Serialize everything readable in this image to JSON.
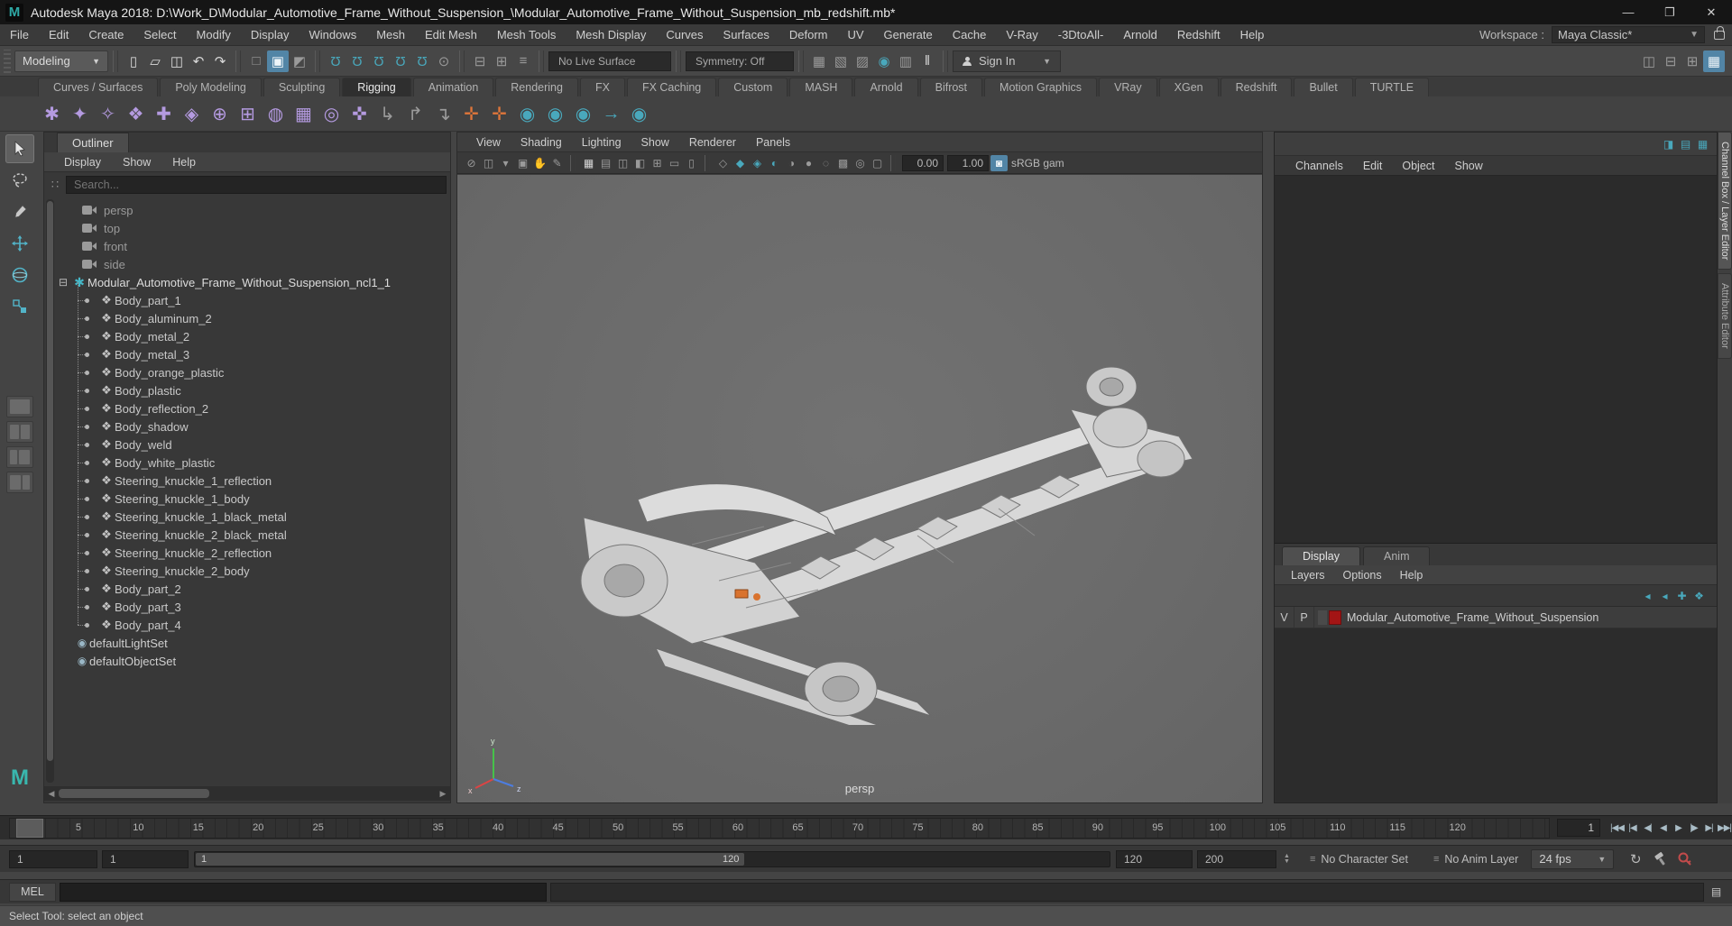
{
  "window": {
    "logo": "M",
    "title": "Autodesk Maya 2018: D:\\Work_D\\Modular_Automotive_Frame_Without_Suspension_\\Modular_Automotive_Frame_Without_Suspension_mb_redshift.mb*",
    "minimize": "—",
    "maximize": "❐",
    "close": "✕"
  },
  "menubar": {
    "items": [
      {
        "label": "File"
      },
      {
        "label": "Edit"
      },
      {
        "label": "Create"
      },
      {
        "label": "Select"
      },
      {
        "label": "Modify"
      },
      {
        "label": "Display"
      },
      {
        "label": "Windows"
      },
      {
        "label": "Mesh"
      },
      {
        "label": "Edit Mesh"
      },
      {
        "label": "Mesh Tools"
      },
      {
        "label": "Mesh Display"
      },
      {
        "label": "Curves"
      },
      {
        "label": "Surfaces"
      },
      {
        "label": "Deform"
      },
      {
        "label": "UV"
      },
      {
        "label": "Generate"
      },
      {
        "label": "Cache"
      },
      {
        "label": "V-Ray"
      },
      {
        "label": "-3DtoAll-"
      },
      {
        "label": "Arnold"
      },
      {
        "label": "Redshift"
      },
      {
        "label": "Help"
      }
    ],
    "workspace_label": "Workspace :",
    "workspace_value": "Maya Classic*",
    "dropdown_arrow": "▼"
  },
  "statusline": {
    "mode": "Modeling",
    "icons_file": [
      {
        "n": "new-scene-icon",
        "g": "▯",
        "cls": "c-light"
      },
      {
        "n": "open-scene-icon",
        "g": "▱",
        "cls": "c-light"
      },
      {
        "n": "save-scene-icon",
        "g": "◫",
        "cls": "c-light"
      },
      {
        "n": "undo-icon",
        "g": "↶",
        "cls": "c-light"
      },
      {
        "n": "redo-icon",
        "g": "↷",
        "cls": "c-light"
      }
    ],
    "icons_select": [
      {
        "n": "select-hierarchy-icon",
        "g": "□",
        "cls": "c-dim"
      },
      {
        "n": "select-object-icon",
        "g": "▣",
        "cls": "act"
      },
      {
        "n": "select-component-icon",
        "g": "◩",
        "cls": "c-dim"
      }
    ],
    "icons_snap": [
      {
        "n": "snap-grid-icon",
        "g": "Ω",
        "cls": "c-teal rot180"
      },
      {
        "n": "snap-curve-icon",
        "g": "Ω",
        "cls": "c-teal rot180"
      },
      {
        "n": "snap-point-icon",
        "g": "Ω",
        "cls": "c-teal rot180"
      },
      {
        "n": "snap-projected-center-icon",
        "g": "Ω",
        "cls": "c-teal rot180"
      },
      {
        "n": "snap-view-plane-icon",
        "g": "Ω",
        "cls": "c-teal rot180"
      },
      {
        "n": "make-live-icon",
        "g": "⊙",
        "cls": "c-dim"
      }
    ],
    "icons_history": [
      {
        "n": "input-connections-icon",
        "g": "⊟",
        "cls": "c-dim"
      },
      {
        "n": "output-connections-icon",
        "g": "⊞",
        "cls": "c-dim"
      },
      {
        "n": "construction-history-icon",
        "g": "≡",
        "cls": "c-dim"
      }
    ],
    "live_surface": "No Live Surface",
    "symmetry": "Symmetry: Off",
    "icons_render": [
      {
        "n": "render-view-icon",
        "g": "▦",
        "cls": "c-dim"
      },
      {
        "n": "render-frame-icon",
        "g": "▧",
        "cls": "c-dim"
      },
      {
        "n": "ipr-render-icon",
        "g": "▨",
        "cls": "c-dim"
      },
      {
        "n": "render-settings-icon",
        "g": "◉",
        "cls": "c-teal"
      },
      {
        "n": "launch-render-icon",
        "g": "▥",
        "cls": "c-dim"
      },
      {
        "n": "pause-viewport-icon",
        "g": "‖",
        "cls": "c-light"
      }
    ],
    "sign_in": "Sign In",
    "panel_icons": [
      {
        "n": "single-pane-layout-icon",
        "g": "◫",
        "cls": "c-dim"
      },
      {
        "n": "two-pane-layout-icon",
        "g": "⊟",
        "cls": "c-dim"
      },
      {
        "n": "four-pane-layout-icon",
        "g": "⊞",
        "cls": "c-dim"
      },
      {
        "n": "current-layout-icon",
        "g": "▦",
        "cls": "act"
      }
    ]
  },
  "shelf": {
    "tabs": [
      {
        "label": "Curves / Surfaces"
      },
      {
        "label": "Poly Modeling"
      },
      {
        "label": "Sculpting"
      },
      {
        "label": "Rigging",
        "cls": "active"
      },
      {
        "label": "Animation"
      },
      {
        "label": "Rendering"
      },
      {
        "label": "FX"
      },
      {
        "label": "FX Caching"
      },
      {
        "label": "Custom"
      },
      {
        "label": "MASH"
      },
      {
        "label": "Arnold"
      },
      {
        "label": "Bifrost"
      },
      {
        "label": "Motion Graphics"
      },
      {
        "label": "VRay"
      },
      {
        "label": "XGen"
      },
      {
        "label": "Redshift"
      },
      {
        "label": "Bullet"
      },
      {
        "label": "TURTLE"
      }
    ],
    "icons": [
      {
        "n": "create-joint-icon",
        "g": "✱",
        "cls": "c-purple"
      },
      {
        "n": "ik-handle-icon",
        "g": "✦",
        "cls": "c-purple"
      },
      {
        "n": "ik-spline-icon",
        "g": "✧",
        "cls": "c-purple"
      },
      {
        "n": "constraint-icon",
        "g": "❖",
        "cls": "c-purple"
      },
      {
        "n": "skeleton-icon",
        "g": "✚",
        "cls": "c-purple"
      },
      {
        "n": "bind-skin-icon",
        "g": "◈",
        "cls": "c-purple"
      },
      {
        "n": "paint-weights-icon",
        "g": "⊕",
        "cls": "c-purple"
      },
      {
        "n": "blend-shape-icon",
        "g": "⊞",
        "cls": "c-purple"
      },
      {
        "n": "cluster-icon",
        "g": "◍",
        "cls": "c-purple"
      },
      {
        "n": "lattice-icon",
        "g": "▦",
        "cls": "c-purple"
      },
      {
        "n": "wrap-deformer-icon",
        "g": "◎",
        "cls": "c-purple"
      },
      {
        "n": "pose-interpolator-icon",
        "g": "✜",
        "cls": "c-purple"
      },
      {
        "n": "connect-joint-icon",
        "g": "↳",
        "cls": "c-dim"
      },
      {
        "n": "reroot-skeleton-icon",
        "g": "↱",
        "cls": "c-dim"
      },
      {
        "n": "orient-joint-icon",
        "g": "↴",
        "cls": "c-dim"
      },
      {
        "n": "joint-size-icon",
        "g": "✛",
        "cls": "c-orange"
      },
      {
        "n": "joint-mirror-icon",
        "g": "✛",
        "cls": "c-orange"
      },
      {
        "n": "muscle-icon",
        "g": "◉",
        "cls": "c-teal"
      },
      {
        "n": "muscle-builder-icon",
        "g": "◉",
        "cls": "c-teal"
      },
      {
        "n": "muscle-spline-icon",
        "g": "◉",
        "cls": "c-teal"
      },
      {
        "n": "motion-path-icon",
        "g": "→",
        "cls": "c-teal"
      },
      {
        "n": "rivet-icon",
        "g": "◉",
        "cls": "c-teal"
      }
    ]
  },
  "outliner": {
    "title": "Outliner",
    "menus": [
      {
        "label": "Display"
      },
      {
        "label": "Show"
      },
      {
        "label": "Help"
      }
    ],
    "search_placeholder": "Search...",
    "filter_glyph": "∷",
    "cameras": [
      {
        "label": "persp"
      },
      {
        "label": "top"
      },
      {
        "label": "front"
      },
      {
        "label": "side"
      }
    ],
    "expander": "⊟",
    "root_icon": "✱",
    "mesh_icon": "❖",
    "set_icon": "◉",
    "root_label": "Modular_Automotive_Frame_Without_Suspension_ncl1_1",
    "children": [
      {
        "label": "Body_part_1"
      },
      {
        "label": "Body_aluminum_2"
      },
      {
        "label": "Body_metal_2"
      },
      {
        "label": "Body_metal_3"
      },
      {
        "label": "Body_orange_plastic"
      },
      {
        "label": "Body_plastic"
      },
      {
        "label": "Body_reflection_2"
      },
      {
        "label": "Body_shadow"
      },
      {
        "label": "Body_weld"
      },
      {
        "label": "Body_white_plastic"
      },
      {
        "label": "Steering_knuckle_1_reflection"
      },
      {
        "label": "Steering_knuckle_1_body"
      },
      {
        "label": "Steering_knuckle_1_black_metal"
      },
      {
        "label": "Steering_knuckle_2_black_metal"
      },
      {
        "label": "Steering_knuckle_2_reflection"
      },
      {
        "label": "Steering_knuckle_2_body"
      },
      {
        "label": "Body_part_2"
      },
      {
        "label": "Body_part_3"
      },
      {
        "label": "Body_part_4"
      }
    ],
    "sets": [
      {
        "label": "defaultLightSet"
      },
      {
        "label": "defaultObjectSet"
      }
    ],
    "hscroll_left": "◀",
    "hscroll_right": "▶"
  },
  "viewport": {
    "menus": [
      {
        "label": "View"
      },
      {
        "label": "Shading"
      },
      {
        "label": "Lighting"
      },
      {
        "label": "Show"
      },
      {
        "label": "Renderer"
      },
      {
        "label": "Panels"
      }
    ],
    "icons_a": [
      {
        "n": "select-camera-icon",
        "g": "⊘",
        "cls": "c-dim sm"
      },
      {
        "n": "camera-attributes-icon",
        "g": "◫",
        "cls": "c-dim sm"
      },
      {
        "n": "bookmarks-icon",
        "g": "▾",
        "cls": "c-dim sm"
      },
      {
        "n": "image-plane-icon",
        "g": "▣",
        "cls": "c-dim sm"
      },
      {
        "n": "2d-pan-zoom-icon",
        "g": "✋",
        "cls": "c-dim sm"
      },
      {
        "n": "grease-pencil-icon",
        "g": "✎",
        "cls": "c-dim sm"
      }
    ],
    "icons_b": [
      {
        "n": "grid-icon",
        "g": "▦",
        "cls": "c-light sm"
      },
      {
        "n": "film-gate-icon",
        "g": "▤",
        "cls": "c-dim sm"
      },
      {
        "n": "resolution-gate-icon",
        "g": "◫",
        "cls": "c-dim sm"
      },
      {
        "n": "gate-mask-icon",
        "g": "◧",
        "cls": "c-dim sm"
      },
      {
        "n": "field-chart-icon",
        "g": "⊞",
        "cls": "c-dim sm"
      },
      {
        "n": "safe-action-icon",
        "g": "▭",
        "cls": "c-dim sm"
      },
      {
        "n": "safe-title-icon",
        "g": "▯",
        "cls": "c-dim sm"
      }
    ],
    "icons_c": [
      {
        "n": "wireframe-icon",
        "g": "◇",
        "cls": "c-dim sm"
      },
      {
        "n": "shaded-icon",
        "g": "◆",
        "cls": "c-teal sm"
      },
      {
        "n": "textured-icon",
        "g": "◈",
        "cls": "c-teal sm"
      },
      {
        "n": "use-all-lights-icon",
        "g": "◐",
        "cls": "c-teal sm"
      },
      {
        "n": "shadows-icon",
        "g": "◑",
        "cls": "c-dim sm"
      },
      {
        "n": "screen-space-ao-icon",
        "g": "●",
        "cls": "c-dim sm"
      },
      {
        "n": "motion-blur-icon",
        "g": "◌",
        "cls": "c-dim sm"
      },
      {
        "n": "multisampling-icon",
        "g": "▩",
        "cls": "c-dim sm"
      },
      {
        "n": "depth-of-field-icon",
        "g": "◎",
        "cls": "c-dim sm"
      },
      {
        "n": "isolate-select-icon",
        "g": "▢",
        "cls": "c-dim sm"
      }
    ],
    "exposure": "0.00",
    "gamma": "1.00",
    "colorspace_icon": {
      "n": "view-transform-icon",
      "g": "◙",
      "cls": "c-blue sm"
    },
    "colorspace": "sRGB gam",
    "camera_label": "persp"
  },
  "channel_box": {
    "corner_icons": [
      {
        "n": "show-channel-box-icon",
        "g": "◨",
        "cls": "c-teal sm"
      },
      {
        "n": "show-layer-editor-icon",
        "g": "▤",
        "cls": "c-teal sm"
      },
      {
        "n": "show-both-icon",
        "g": "▦",
        "cls": "c-teal sm"
      }
    ],
    "menus": [
      {
        "label": "Channels"
      },
      {
        "label": "Edit"
      },
      {
        "label": "Object"
      },
      {
        "label": "Show"
      }
    ]
  },
  "layer_editor": {
    "tabs": [
      {
        "label": "Display",
        "cls": "active"
      },
      {
        "label": "Anim"
      }
    ],
    "menus": [
      {
        "label": "Layers"
      },
      {
        "label": "Options"
      },
      {
        "label": "Help"
      }
    ],
    "icons": [
      {
        "n": "move-layer-up-icon",
        "g": "◂",
        "cls": "c-teal sm"
      },
      {
        "n": "move-layer-down-icon",
        "g": "◂",
        "cls": "c-teal sm"
      },
      {
        "n": "empty-layer-icon",
        "g": "✚",
        "cls": "c-teal sm"
      },
      {
        "n": "layer-from-selected-icon",
        "g": "❖",
        "cls": "c-teal sm"
      }
    ],
    "layer": {
      "visible": "V",
      "playback": "P",
      "name": "Modular_Automotive_Frame_Without_Suspension"
    }
  },
  "side_tabs": [
    {
      "label": "Channel Box / Layer Editor",
      "cls": "active"
    },
    {
      "label": "Attribute Editor"
    }
  ],
  "timeline": {
    "ticks": [
      {
        "label": "5"
      },
      {
        "label": "10"
      },
      {
        "label": "15"
      },
      {
        "label": "20"
      },
      {
        "label": "25"
      },
      {
        "label": "30"
      },
      {
        "label": "35"
      },
      {
        "label": "40"
      },
      {
        "label": "45"
      },
      {
        "label": "50"
      },
      {
        "label": "55"
      },
      {
        "label": "60"
      },
      {
        "label": "65"
      },
      {
        "label": "70"
      },
      {
        "label": "75"
      },
      {
        "label": "80"
      },
      {
        "label": "85"
      },
      {
        "label": "90"
      },
      {
        "label": "95"
      },
      {
        "label": "100"
      },
      {
        "label": "105"
      },
      {
        "label": "110"
      },
      {
        "label": "115"
      },
      {
        "label": "120"
      }
    ],
    "frame_field": "1",
    "playback": [
      {
        "n": "go-to-start-button",
        "g": "|◀◀"
      },
      {
        "n": "step-back-frame-button",
        "g": "|◀"
      },
      {
        "n": "step-back-key-button",
        "g": "◀|"
      },
      {
        "n": "play-backwards-button",
        "g": "◀"
      },
      {
        "n": "play-forwards-button",
        "g": "▶"
      },
      {
        "n": "step-forward-key-button",
        "g": "|▶"
      },
      {
        "n": "step-forward-frame-button",
        "g": "▶|"
      },
      {
        "n": "go-to-end-button",
        "g": "▶▶|"
      }
    ]
  },
  "range": {
    "anim_start": "1",
    "start": "1",
    "bar_start": "1",
    "bar_end": "120",
    "end": "120",
    "anim_end": "200",
    "spin_up": "▲",
    "spin_down": "▼",
    "character": "No Character Set",
    "anim_layer": "No Anim Layer",
    "fps": "24 fps",
    "ddl_icon": "≡"
  },
  "cmd": {
    "label": "MEL"
  },
  "help": {
    "text": "Select Tool: select an object"
  },
  "colors": {
    "accent": "#5285a6",
    "teal": "#49a8bc",
    "purple": "#b49ae0",
    "orange": "#e0763a",
    "layer_swatch": "#a31515",
    "viewport_bg": "#6a6a6a"
  }
}
